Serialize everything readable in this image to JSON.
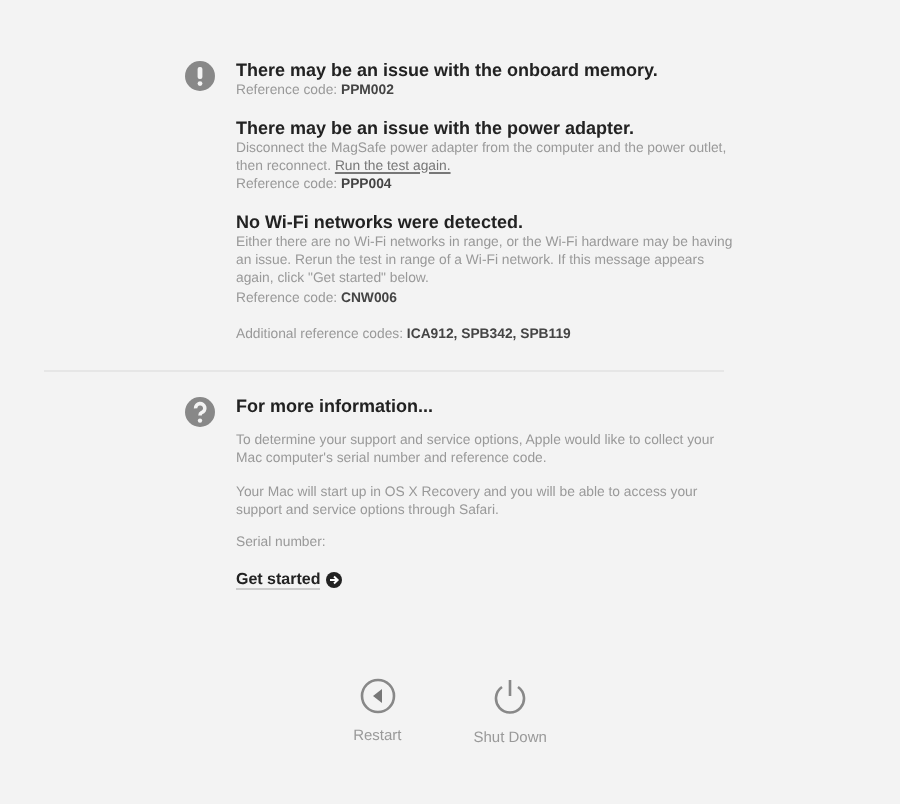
{
  "issues": [
    {
      "title": "There may be an issue with the onboard memory.",
      "reference": "Reference code: **PPM002**"
    },
    {
      "title": "There may be an issue with the power adapter.",
      "description": "Disconnect the MagSafe power adapter from the computer and the power outlet, then reconnect.",
      "link": "Run the test again.",
      "reference": "Reference code: **PPP004**"
    },
    {
      "title": "No Wi-Fi networks were detected.",
      "description": "Either there are no Wi-Fi networks in range, or the Wi-Fi hardware may be having an issue. Rerun the test in range of a Wi-Fi network. If this message appears again, click \"Get started\" below.",
      "reference": "Reference code: **CNW006**"
    }
  ],
  "additional": "Additional reference codes: **ICA912, SPB342, SPB119**",
  "info": {
    "title": "For more information...",
    "paragraphs": [
      "To determine your support and service options, Apple would like to collect your Mac computer's serial number and reference code.",
      "Your Mac will start up in OS X Recovery and you will be able to access your support and service options through Safari."
    ],
    "serial_label": "Serial number:",
    "action": "Get started"
  },
  "buttons": [
    {
      "kind": "restart",
      "label": "Restart"
    },
    {
      "kind": "shutdown",
      "label": "Shut Down"
    }
  ]
}
